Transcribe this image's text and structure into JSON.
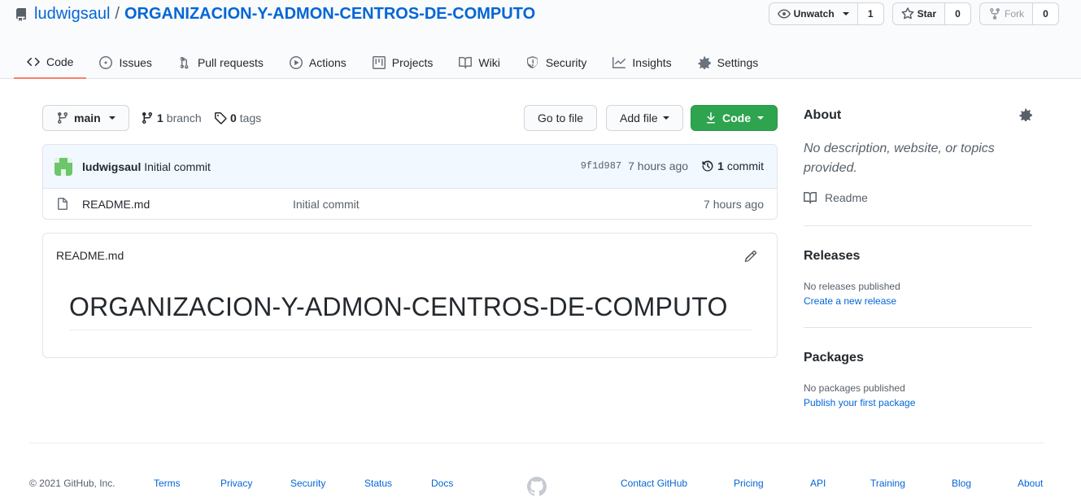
{
  "repo": {
    "owner": "ludwigsaul",
    "separator": "/",
    "name": "ORGANIZACION-Y-ADMON-CENTROS-DE-COMPUTO"
  },
  "header_buttons": {
    "watch": {
      "label": "Unwatch",
      "count": "1"
    },
    "star": {
      "label": "Star",
      "count": "0"
    },
    "fork": {
      "label": "Fork",
      "count": "0"
    }
  },
  "tabs": [
    {
      "label": "Code",
      "icon": "code-icon",
      "active": true
    },
    {
      "label": "Issues",
      "icon": "issue-icon"
    },
    {
      "label": "Pull requests",
      "icon": "pull-request-icon"
    },
    {
      "label": "Actions",
      "icon": "play-icon"
    },
    {
      "label": "Projects",
      "icon": "project-icon"
    },
    {
      "label": "Wiki",
      "icon": "book-icon"
    },
    {
      "label": "Security",
      "icon": "shield-icon"
    },
    {
      "label": "Insights",
      "icon": "graph-icon"
    },
    {
      "label": "Settings",
      "icon": "gear-icon"
    }
  ],
  "toolbar": {
    "branch": "main",
    "branch_count": "1",
    "branch_label": "branch",
    "tag_count": "0",
    "tag_label": "tags",
    "goto_file": "Go to file",
    "add_file": "Add file",
    "code": "Code"
  },
  "latest_commit": {
    "author": "ludwigsaul",
    "message": "Initial commit",
    "sha": "9f1d987",
    "age": "7 hours ago",
    "commit_count": "1",
    "commit_label": "commit"
  },
  "files": [
    {
      "name": "README.md",
      "message": "Initial commit",
      "age": "7 hours ago"
    }
  ],
  "readme": {
    "filename": "README.md",
    "heading": "ORGANIZACION-Y-ADMON-CENTROS-DE-COMPUTO"
  },
  "sidebar": {
    "about": {
      "title": "About",
      "description": "No description, website, or topics provided.",
      "readme_link": "Readme"
    },
    "releases": {
      "title": "Releases",
      "empty": "No releases published",
      "link": "Create a new release"
    },
    "packages": {
      "title": "Packages",
      "empty": "No packages published",
      "link": "Publish your first package"
    }
  },
  "footer": {
    "copyright": "© 2021 GitHub, Inc.",
    "left_links": [
      "Terms",
      "Privacy",
      "Security",
      "Status",
      "Docs"
    ],
    "right_links": [
      "Contact GitHub",
      "Pricing",
      "API",
      "Training",
      "Blog",
      "About"
    ]
  },
  "colors": {
    "link": "#0366d6",
    "primary_button": "#2ea44f",
    "active_tab_underline": "#f9826c"
  }
}
